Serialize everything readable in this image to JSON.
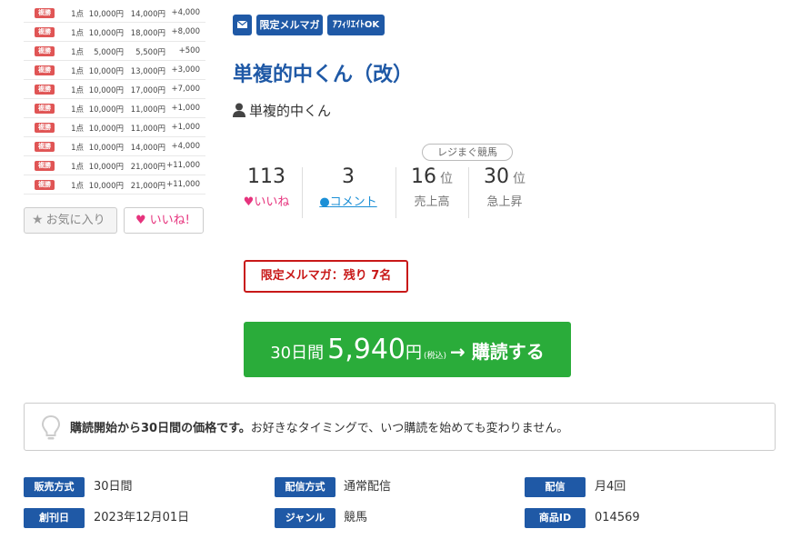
{
  "results": [
    {
      "type": "複勝",
      "qty": "1点",
      "bet": "10,000円",
      "payout": "14,000円",
      "profit": "+4,000"
    },
    {
      "type": "複勝",
      "qty": "1点",
      "bet": "10,000円",
      "payout": "18,000円",
      "profit": "+8,000"
    },
    {
      "type": "複勝",
      "qty": "1点",
      "bet": "5,000円",
      "payout": "5,500円",
      "profit": "+500"
    },
    {
      "type": "複勝",
      "qty": "1点",
      "bet": "10,000円",
      "payout": "13,000円",
      "profit": "+3,000"
    },
    {
      "type": "複勝",
      "qty": "1点",
      "bet": "10,000円",
      "payout": "17,000円",
      "profit": "+7,000"
    },
    {
      "type": "複勝",
      "qty": "1点",
      "bet": "10,000円",
      "payout": "11,000円",
      "profit": "+1,000"
    },
    {
      "type": "複勝",
      "qty": "1点",
      "bet": "10,000円",
      "payout": "11,000円",
      "profit": "+1,000"
    },
    {
      "type": "複勝",
      "qty": "1点",
      "bet": "10,000円",
      "payout": "14,000円",
      "profit": "+4,000"
    },
    {
      "type": "複勝",
      "qty": "1点",
      "bet": "10,000円",
      "payout": "21,000円",
      "profit": "+11,000"
    },
    {
      "type": "複勝",
      "qty": "1点",
      "bet": "10,000円",
      "payout": "21,000円",
      "profit": "+11,000"
    }
  ],
  "buttons": {
    "favorite": "お気に入り",
    "like": "いいね!"
  },
  "tags": {
    "mail_icon": "mail-icon",
    "limited": "限定メルマガ",
    "affiliate": "ｱﾌｨﾘｴｲﾄOK"
  },
  "title": "単複的中くん（改）",
  "author": "単複的中くん",
  "stats": {
    "ranking_label": "レジまぐ競馬",
    "likes_count": "113",
    "likes_label": "いいね",
    "comments_count": "3",
    "comments_label": "コメント",
    "sales_rank": "16",
    "sales_unit": "位",
    "sales_label": "売上高",
    "rise_rank": "30",
    "rise_unit": "位",
    "rise_label": "急上昇"
  },
  "remaining": "限定メルマガ：残り 7名",
  "subscribe": {
    "period": "30日間",
    "price": "5,940",
    "yen": "円",
    "tax": "(税込)",
    "cta": "→ 購読する"
  },
  "notice": {
    "bold": "購読開始から30日間の価格です。",
    "text": "お好きなタイミングで、いつ購読を始めても変わりません。"
  },
  "info": {
    "sale_method_label": "販売方式",
    "sale_method": "30日間",
    "delivery_method_label": "配信方式",
    "delivery_method": "通常配信",
    "delivery_label": "配信",
    "delivery": "月4回",
    "founded_label": "創刊日",
    "founded": "2023年12月01日",
    "genre_label": "ジャンル",
    "genre": "競馬",
    "product_id_label": "商品ID",
    "product_id": "014569"
  },
  "colors": {
    "accent": "#1f59a6",
    "like": "#e6337d",
    "comment": "#1b8fd6",
    "subscribe": "#2aac3a",
    "alert": "#c81818",
    "badge": "#e05555"
  }
}
